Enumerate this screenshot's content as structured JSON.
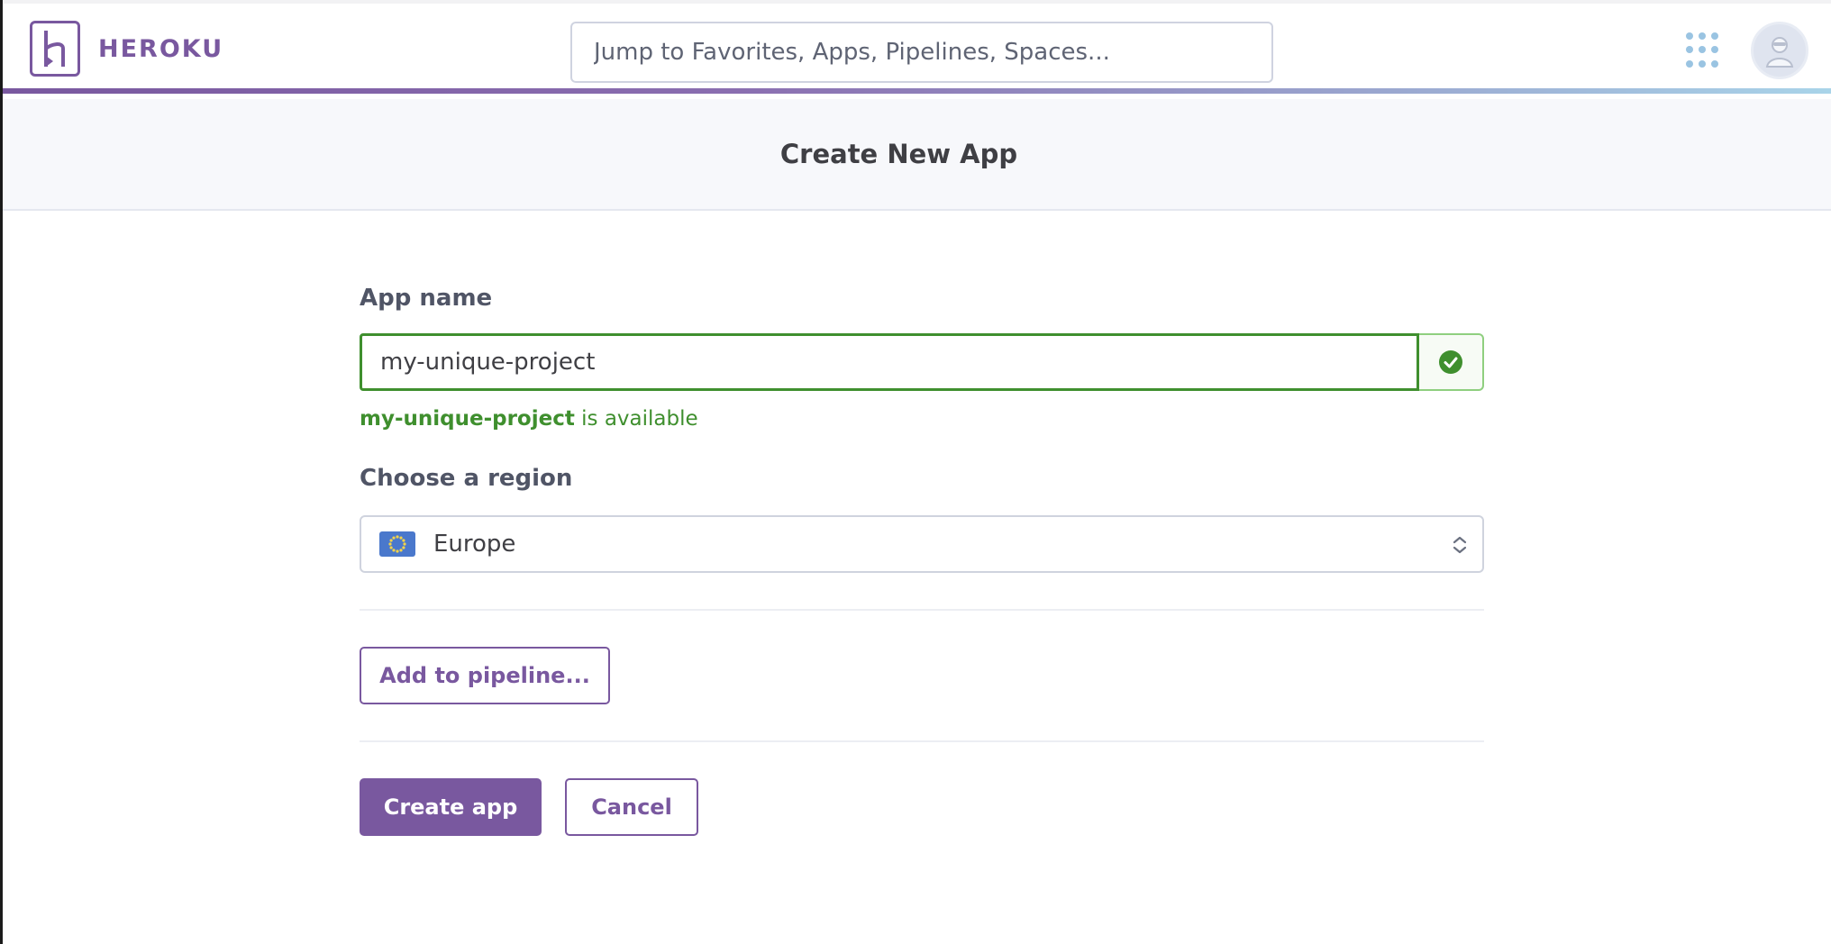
{
  "brand": {
    "name": "HEROKU",
    "color": "#79589f"
  },
  "search": {
    "placeholder": "Jump to Favorites, Apps, Pipelines, Spaces..."
  },
  "icons": {
    "apps": "grid-icon",
    "avatar": "user-avatar-icon",
    "check": "check-circle-icon",
    "flag": "eu-flag-icon",
    "select": "chevron-updown-icon"
  },
  "page": {
    "title": "Create New App"
  },
  "form": {
    "app_name_label": "App name",
    "app_name_value": "my-unique-project",
    "availability": {
      "name": "my-unique-project",
      "suffix": " is available",
      "color": "#3f8f2e"
    },
    "region_label": "Choose a region",
    "region_value": "Europe"
  },
  "buttons": {
    "add_pipeline": "Add to pipeline...",
    "create": "Create app",
    "cancel": "Cancel"
  }
}
